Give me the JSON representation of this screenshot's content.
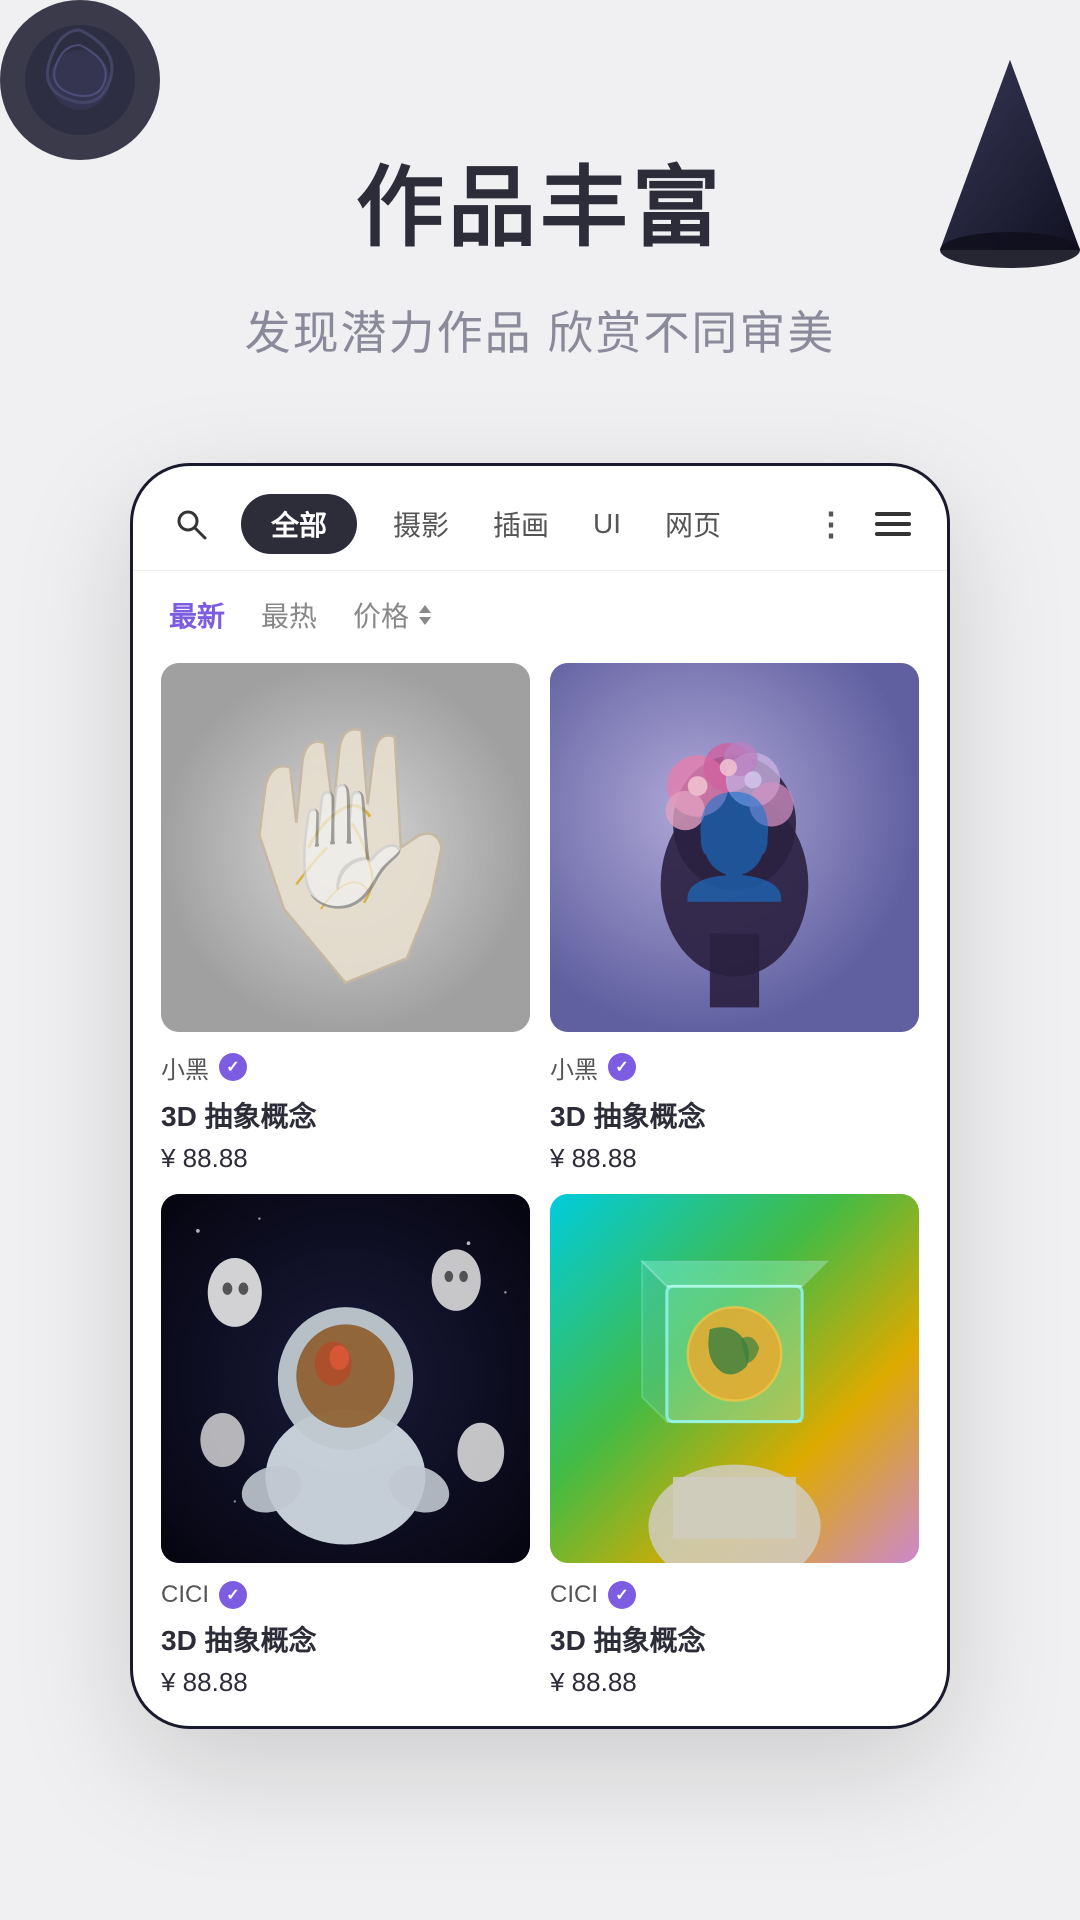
{
  "hero": {
    "title": "作品丰富",
    "subtitle": "发现潜力作品  欣赏不同审美"
  },
  "nav": {
    "search_icon": "search",
    "categories": [
      {
        "id": "all",
        "label": "全部",
        "active": true
      },
      {
        "id": "photo",
        "label": "摄影",
        "active": false
      },
      {
        "id": "illustration",
        "label": "插画",
        "active": false
      },
      {
        "id": "ui",
        "label": "UI",
        "active": false
      },
      {
        "id": "web",
        "label": "网页",
        "active": false
      },
      {
        "id": "more",
        "label": "⋮",
        "active": false
      }
    ]
  },
  "sort": {
    "items": [
      {
        "id": "latest",
        "label": "最新",
        "active": true
      },
      {
        "id": "hot",
        "label": "最热",
        "active": false
      },
      {
        "id": "price",
        "label": "价格",
        "active": false
      }
    ]
  },
  "products": [
    {
      "id": "p1",
      "author": "小黑",
      "verified": true,
      "title": "3D 抽象概念",
      "price": "¥ 88.88",
      "image_type": "hand"
    },
    {
      "id": "p2",
      "author": "小黑",
      "verified": true,
      "title": "3D 抽象概念",
      "price": "¥ 88.88",
      "image_type": "head"
    },
    {
      "id": "p3",
      "author": "CICI",
      "verified": true,
      "title": "3D 抽象概念",
      "price": "¥ 88.88",
      "image_type": "astronaut"
    },
    {
      "id": "p4",
      "author": "CICI",
      "verified": true,
      "title": "3D 抽象概念",
      "price": "¥ 88.88",
      "image_type": "cube"
    }
  ],
  "verified_label": "✓",
  "price_arrow": "⇅",
  "colors": {
    "accent": "#7c5ce0",
    "dark": "#2d2d3a",
    "gray": "#8a8a9a"
  }
}
